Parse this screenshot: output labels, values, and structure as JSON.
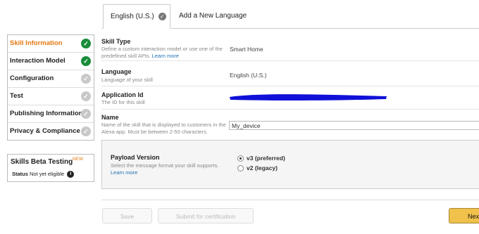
{
  "tabs": {
    "active_label": "English (U.S.)",
    "add_label": "Add a New Language"
  },
  "sidebar": {
    "items": [
      {
        "label": "Skill Information",
        "status": "done"
      },
      {
        "label": "Interaction Model",
        "status": "done"
      },
      {
        "label": "Configuration",
        "status": "todo"
      },
      {
        "label": "Test",
        "status": "todo"
      },
      {
        "label": "Publishing Information",
        "status": "todo"
      },
      {
        "label": "Privacy & Compliance",
        "status": "todo"
      }
    ]
  },
  "beta": {
    "title": "Skills Beta Testing",
    "new_badge": "NEW",
    "status_label": "Status",
    "status_value": "Not yet eligible"
  },
  "form": {
    "skill_type": {
      "label": "Skill Type",
      "desc": "Define a custom interaction model or use one of the predefined skill APIs.",
      "link": "Learn more",
      "value": "Smart Home"
    },
    "language": {
      "label": "Language",
      "desc": "Language of your skill",
      "value": "English (U.S.)"
    },
    "application_id": {
      "label": "Application Id",
      "desc": "The ID for this skill"
    },
    "name": {
      "label": "Name",
      "desc": "Name of the skill that is displayed to customers in the Alexa app. Must be between 2-50 characters.",
      "value": "My_device"
    },
    "payload": {
      "label": "Payload Version",
      "desc": "Select the message format your skill supports.",
      "link": "Learn more",
      "options": [
        {
          "label": "v3 (preferred)",
          "selected": true
        },
        {
          "label": "v2 (legacy)",
          "selected": false
        }
      ]
    }
  },
  "buttons": {
    "save": "Save",
    "submit": "Submit for certification",
    "next": "Next"
  },
  "colors": {
    "accent": "#e47911",
    "done": "#1a8c3a",
    "link": "#1f6fb5",
    "redaction": "#1010d8"
  }
}
